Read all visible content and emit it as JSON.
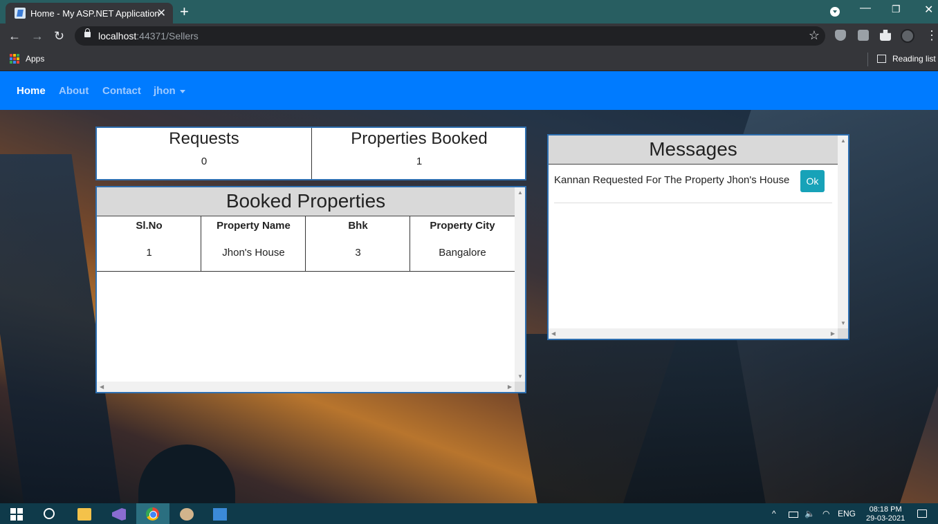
{
  "browser": {
    "tab_title": "Home - My ASP.NET Application",
    "tab_close": "✕",
    "new_tab": "+",
    "url_host": "localhost",
    "url_rest": ":44371/Sellers",
    "bookmarks": {
      "apps_label": "Apps",
      "reading_list_label": "Reading list"
    },
    "window_controls": {
      "minimize": "—",
      "restore": "❐",
      "close": "✕"
    },
    "nav_icons": {
      "back": "←",
      "forward": "→",
      "reload": "↻",
      "star": "☆",
      "menu": "⋮"
    }
  },
  "navbar": {
    "links": [
      {
        "label": "Home",
        "active": true
      },
      {
        "label": "About",
        "active": false
      },
      {
        "label": "Contact",
        "active": false
      }
    ],
    "user_menu": "jhon",
    "color": "#007bff"
  },
  "stats": {
    "requests_label": "Requests",
    "requests_value": "0",
    "booked_label": "Properties Booked",
    "booked_value": "1"
  },
  "booked_properties": {
    "title": "Booked Properties",
    "columns": [
      "Sl.No",
      "Property Name",
      "Bhk",
      "Property City"
    ],
    "rows": [
      [
        "1",
        "Jhon's House",
        "3",
        "Bangalore"
      ]
    ]
  },
  "messages": {
    "title": "Messages",
    "items": [
      {
        "text": "Kannan Requested For The Property Jhon's House",
        "action": "Ok"
      }
    ]
  },
  "taskbar": {
    "tray_lang": "ENG",
    "time": "08:18 PM",
    "date": "29-03-2021",
    "tray_up": "^"
  }
}
